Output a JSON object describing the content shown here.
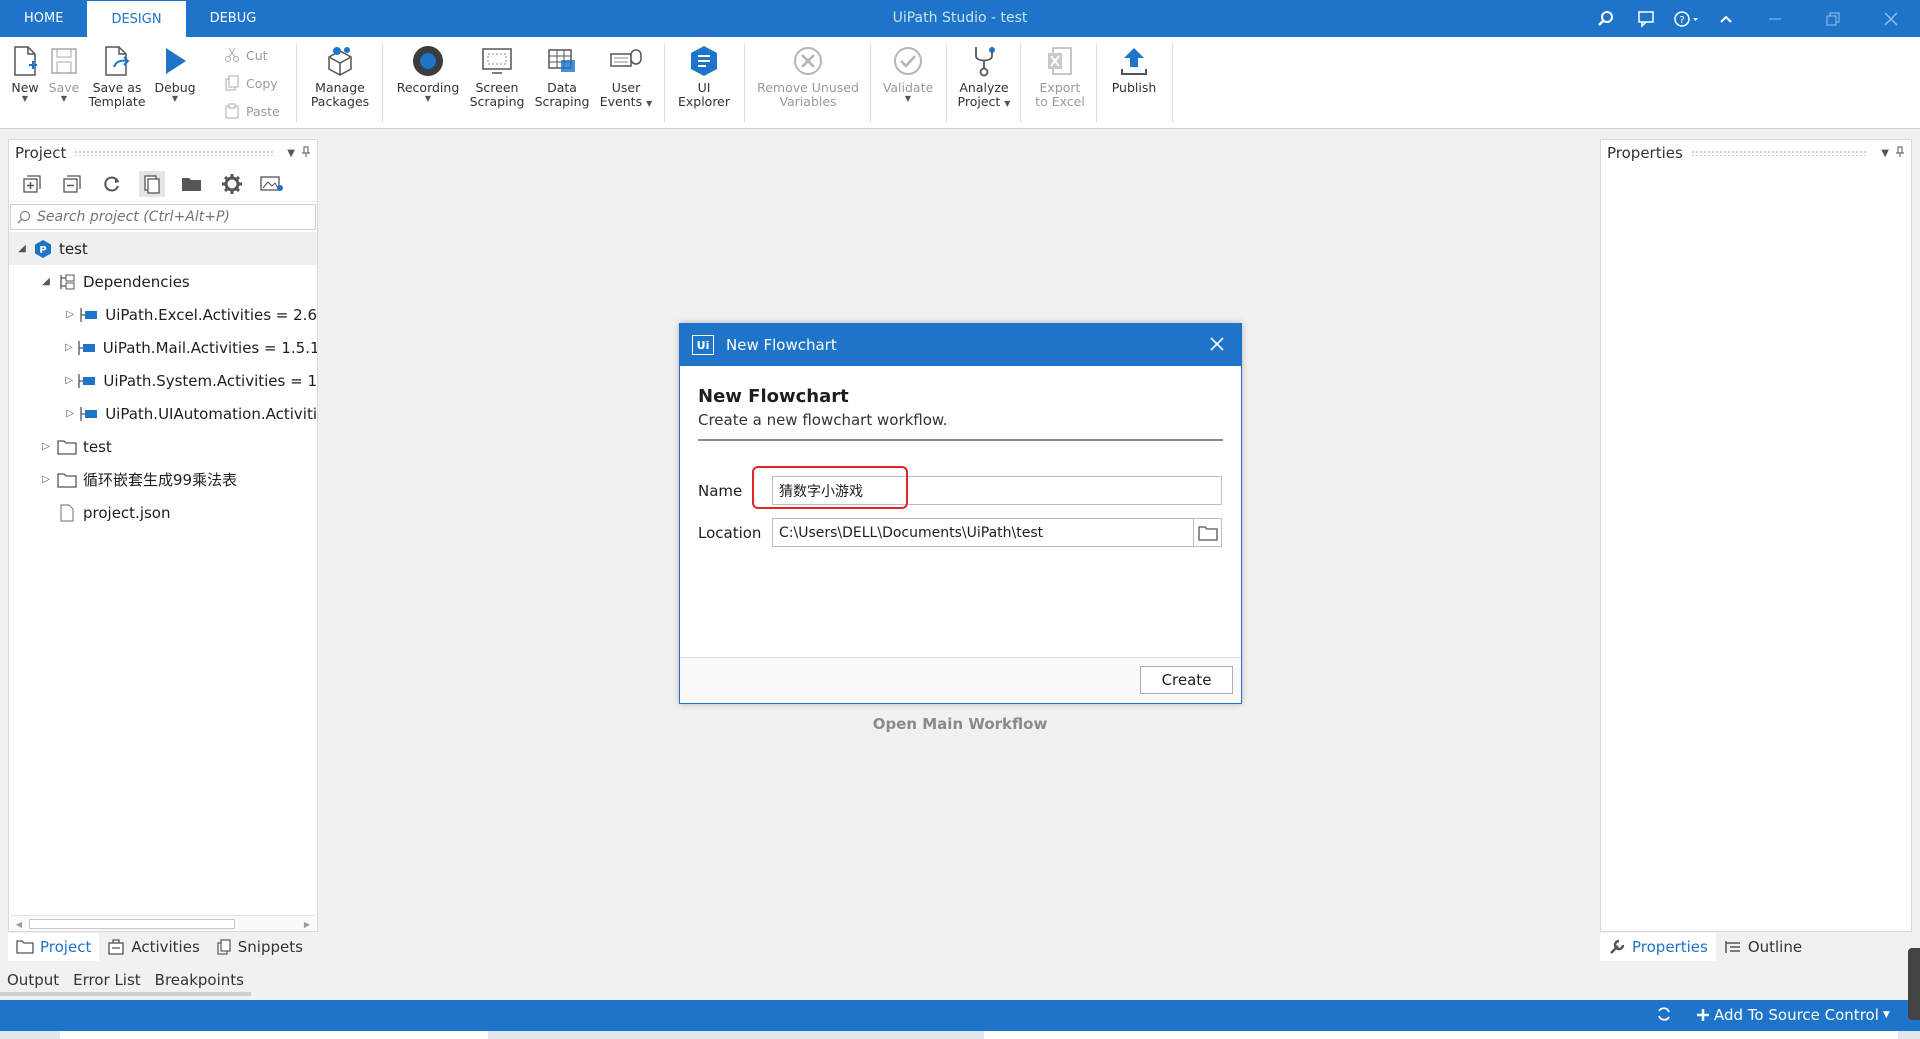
{
  "window": {
    "title": "UiPath Studio - test",
    "tabs": [
      "HOME",
      "DESIGN",
      "DEBUG"
    ],
    "active_tab": "DESIGN"
  },
  "ribbon": {
    "new": "New",
    "save": "Save",
    "save_template_1": "Save as",
    "save_template_2": "Template",
    "debug": "Debug",
    "cut": "Cut",
    "copy": "Copy",
    "paste": "Paste",
    "manage_1": "Manage",
    "manage_2": "Packages",
    "recording": "Recording",
    "screen_1": "Screen",
    "screen_2": "Scraping",
    "data_1": "Data",
    "data_2": "Scraping",
    "user_1": "User",
    "user_2": "Events",
    "ui_1": "UI",
    "ui_2": "Explorer",
    "remove_1": "Remove Unused",
    "remove_2": "Variables",
    "validate": "Validate",
    "analyze_1": "Analyze",
    "analyze_2": "Project",
    "export_1": "Export",
    "export_2": "to Excel",
    "publish": "Publish"
  },
  "project_panel": {
    "title": "Project",
    "search_placeholder": "Search project (Ctrl+Alt+P)",
    "tree": {
      "root": "test",
      "dependencies": "Dependencies",
      "dep_excel": "UiPath.Excel.Activities = 2.6",
      "dep_mail": "UiPath.Mail.Activities = 1.5.1",
      "dep_system": "UiPath.System.Activities = 1",
      "dep_ui": "UiPath.UIAutomation.Activiti",
      "folder_test": "test",
      "folder_loop": "循环嵌套生成99乘法表",
      "file_project": "project.json"
    }
  },
  "left_tabs": [
    "Project",
    "Activities",
    "Snippets"
  ],
  "output_tabs": [
    "Output",
    "Error List",
    "Breakpoints"
  ],
  "properties_panel": {
    "title": "Properties"
  },
  "right_tabs": [
    "Properties",
    "Outline"
  ],
  "center": {
    "open_main": "Open Main Workflow"
  },
  "dialog": {
    "title": "New Flowchart",
    "logo": "Ui",
    "heading": "New Flowchart",
    "subtitle": "Create a new flowchart workflow.",
    "name_label": "Name",
    "name_value": "猜数字小游戏",
    "location_label": "Location",
    "location_value": "C:\\Users\\DELL\\Documents\\UiPath\\test",
    "create_button": "Create"
  },
  "statusbar": {
    "source_control": "Add To Source Control"
  },
  "colors": {
    "accent": "#1e74c8",
    "highlight": "#e02525"
  }
}
